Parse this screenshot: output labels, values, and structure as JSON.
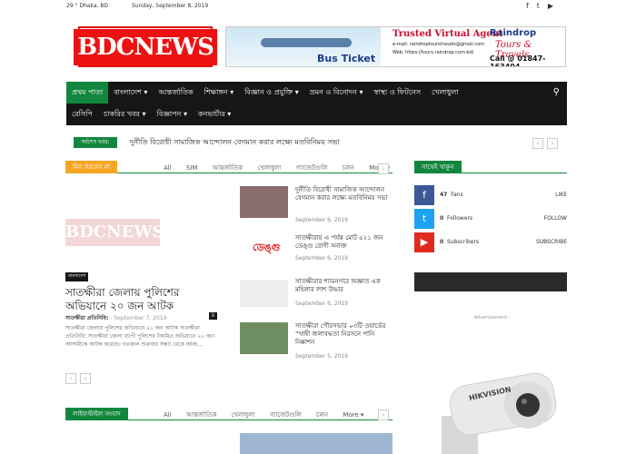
{
  "topbar": {
    "weather": "29 ° Dhaka, BD",
    "date": "Sunday, September 8, 2019",
    "social_icons": [
      "facebook-icon",
      "twitter-icon",
      "youtube-icon"
    ]
  },
  "logo": {
    "text": "BDCNEWS"
  },
  "banner": {
    "bus_ticket": "Bus Ticket",
    "agent": "Trusted Virtual Agent",
    "email": "e-mail: raindroptourstravels@gmail.com",
    "web": "Web: https://tours.raindrop.com.bd/",
    "brand": "Raindrop",
    "brand_sub": "Tours & Travels",
    "phone": "Call @ 01847-163404"
  },
  "nav": {
    "row1": [
      "প্রথম পাতা",
      "বাংলাদেশ ▾",
      "আন্তর্জাতিক",
      "শিক্ষাঙ্গন ▾",
      "বিজ্ঞান ও প্রযুক্তি ▾",
      "ভ্রমন ও বিনোদন ▾",
      "স্বাস্থ্য ও ফিটনেস",
      "খেলাধুলা"
    ],
    "row2": [
      "রেসিপি",
      "চাকরির খবর ▾",
      "বিজ্ঞাপন ▾",
      "কনভার্টার ▾"
    ]
  },
  "ticker": {
    "label": "সর্বশেষ খবর:",
    "text": "দুর্নীতি বিরোধী সামাজিক আন্দোলন বেগমান করার লক্ষ্যে মতবিনিময় সভা"
  },
  "section1": {
    "label": "মিস করবেন না",
    "tabs": [
      "All",
      "SIM",
      "আন্তর্জাতিক",
      "খেলাধুলা",
      "গ্যাজেটগুলি",
      "চলন",
      "More ▾"
    ]
  },
  "featured": {
    "thumb_logo": "BDCNEWS",
    "category": "বাংলাদেশ",
    "title": "সাতক্ষীরা জেলায় পুলিশের অভিযানে ২০ জন আটক",
    "author": "সাতক্ষীরা প্রতিনিধি:",
    "date": "- September 7, 2019",
    "comments": "0",
    "excerpt": "সাতক্ষীরা জেলায় পুলিশের অভিযানে ২০ জন আটক সাতক্ষীরা প্রতিনিধি: সাতক্ষীরা জেলা ব্যাপী পুলিশের নিয়মিত অভিযানে ২০ জন আসামীকে আটক করেছে। গতকাল শুক্রবার সন্ধ্যা থেকে আজ..."
  },
  "side_articles": [
    {
      "title": "দুর্নীতি বিরোধী সামাজিক আন্দোলন বেগমান করার লক্ষ্যে মতবিনিময় সভা",
      "date": "September 6, 2019"
    },
    {
      "title": "সাতক্ষীরায় এ পর্যন্ত মোট ৫২১ জন ডেঙ্গু রোগী সনাক্ত",
      "date": "September 6, 2019",
      "thumb_text": "ডেঙ্গু"
    },
    {
      "title": "সাতক্ষীরার শ্যামনগরে অজ্ঞাত এক মহিলার লাশ উদ্ধার",
      "date": "September 6, 2019"
    },
    {
      "title": "সাতক্ষীরা পৌরসভার ০৩টি ওয়ার্ডের “খাষী জলাবদ্ধতা নিরসনে পানি নিষ্কাশন",
      "date": "September 5, 2019"
    }
  ],
  "section2": {
    "label": "লাইফস্টাইল সংবাদ",
    "tabs": [
      "All",
      "আন্তর্জাতিক",
      "খেলাধুলা",
      "গ্যাজেটগুলি",
      "চলন",
      "More ▾"
    ]
  },
  "sidebar": {
    "label": "সাথেই থাকুন",
    "social": [
      {
        "icon": "facebook-icon",
        "count": "47",
        "unit": "Fans",
        "action": "LIKE",
        "color": "#3b5998"
      },
      {
        "icon": "twitter-icon",
        "count": "0",
        "unit": "Followers",
        "action": "FOLLOW",
        "color": "#1da1f2"
      },
      {
        "icon": "youtube-icon",
        "count": "0",
        "unit": "Subscribers",
        "action": "SUBSCRIBE",
        "color": "#e02a20"
      }
    ],
    "ad_label": "- Advertisement -",
    "camera_brand": "HIKVISION"
  }
}
